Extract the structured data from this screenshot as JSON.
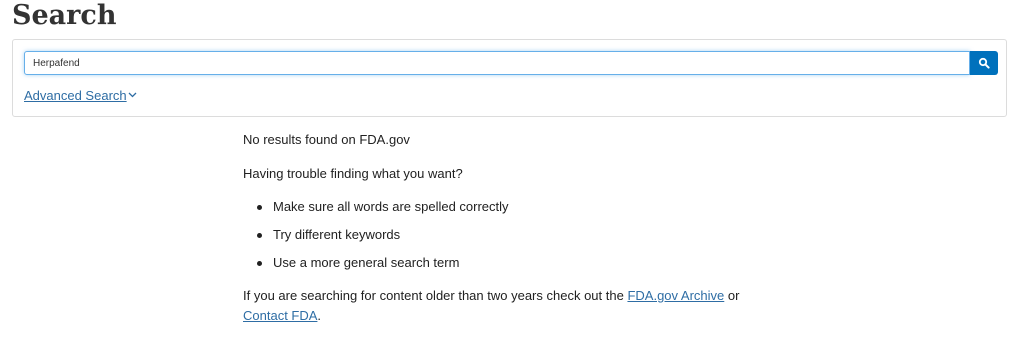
{
  "page": {
    "title": "Search"
  },
  "search": {
    "query": "Herpafend",
    "button_icon": "search-icon",
    "advanced_label": "Advanced Search",
    "advanced_icon": "chevron-down-icon"
  },
  "results": {
    "no_results": "No results found on FDA.gov",
    "trouble_heading": "Having trouble finding what you want?",
    "tips": [
      "Make sure all words are spelled correctly",
      "Try different keywords",
      "Use a more general search term"
    ],
    "older_prefix": "If you are searching for content older than two years check out the ",
    "archive_link": "FDA.gov Archive",
    "older_middle": " or",
    "contact_link": "Contact FDA",
    "older_suffix": "."
  },
  "colors": {
    "accent": "#0071bc",
    "link": "#2e6da4",
    "focus_border": "#66afe9"
  }
}
